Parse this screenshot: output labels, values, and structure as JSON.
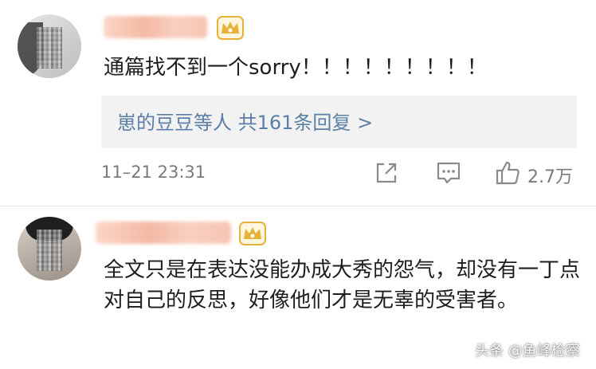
{
  "comments": [
    {
      "text": "通篇找不到一个sorry！！！！！！！！！",
      "reply_summary": "崽的豆豆等人  共161条回复 >",
      "timestamp": "11–21 23:31",
      "like_count": "2.7万",
      "badge_icon": "crown-icon"
    },
    {
      "text": "全文只是在表达没能办成大秀的怨气，却没有一丁点对自己的反思，好像他们才是无辜的受害者。",
      "badge_icon": "crown-icon"
    }
  ],
  "actions": {
    "share_icon": "share-icon",
    "comment_icon": "comment-icon",
    "like_icon": "thumbs-up-icon"
  },
  "watermark": "头条 @鱼峰检察",
  "colors": {
    "link": "#5b7fa6",
    "meta": "#7a7a7a",
    "reply_bg": "#f2f2f2",
    "crown": "#e8b13a"
  }
}
